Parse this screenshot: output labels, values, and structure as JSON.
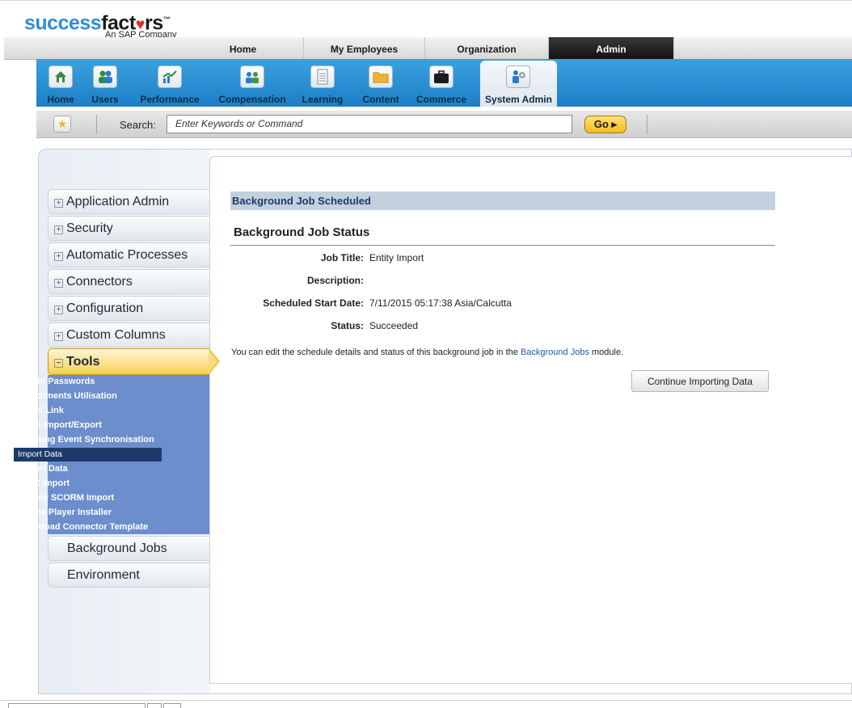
{
  "logo": {
    "part1": "success",
    "part2": "fact",
    "heart": "♥",
    "part3": "rs",
    "tm": "™",
    "subtitle": "An SAP Company"
  },
  "top_nav": [
    {
      "label": "Home",
      "active": false
    },
    {
      "label": "My Employees",
      "active": false
    },
    {
      "label": "Organization",
      "active": false
    },
    {
      "label": "Admin",
      "active": true
    }
  ],
  "modules": [
    {
      "label": "Home",
      "icon": "home-icon",
      "active": false
    },
    {
      "label": "Users",
      "icon": "users-icon",
      "active": false
    },
    {
      "label": "Performance",
      "icon": "performance-chart-icon",
      "active": false
    },
    {
      "label": "Compensation",
      "icon": "compensation-icon",
      "active": false
    },
    {
      "label": "Learning",
      "icon": "document-icon",
      "active": false
    },
    {
      "label": "Content",
      "icon": "folder-icon",
      "active": false
    },
    {
      "label": "Commerce",
      "icon": "briefcase-icon",
      "active": false
    },
    {
      "label": "System Admin",
      "icon": "system-admin-gear-icon",
      "active": true
    }
  ],
  "search": {
    "label": "Search:",
    "placeholder": "Enter Keywords or Command",
    "go_label": "Go ▸"
  },
  "sidebar": {
    "sections": [
      {
        "label": "Application Admin",
        "expand": "+"
      },
      {
        "label": "Security",
        "expand": "+"
      },
      {
        "label": "Automatic Processes",
        "expand": "+"
      },
      {
        "label": "Connectors",
        "expand": "+"
      },
      {
        "label": "Configuration",
        "expand": "+"
      },
      {
        "label": "Custom Columns",
        "expand": "+"
      }
    ],
    "tools": {
      "label": "Tools",
      "expand": "−"
    },
    "tools_items": [
      "Admin Passwords",
      "Attachments Utilisation",
      "Direct Link",
      "Label Import/Export",
      "Learning Event Synchronisation",
      "Import Data",
      "Export Data",
      "AICC Import",
      "Legacy SCORM Import",
      "Offline Player Installer",
      "Download Connector Template"
    ],
    "active_tool": "Import Data",
    "bottom_sections": [
      "Background Jobs",
      "Environment"
    ]
  },
  "job": {
    "header": "Background Job Scheduled",
    "title": "Background Job Status",
    "fields": [
      {
        "label": "Job Title:",
        "value": "Entity Import"
      },
      {
        "label": "Description:",
        "value": ""
      },
      {
        "label": "Scheduled Start Date:",
        "value": "7/11/2015 05:17:38 Asia/Calcutta"
      },
      {
        "label": "Status:",
        "value": "Succeeded"
      }
    ],
    "note_prefix": "You can edit the schedule details and status of this background job in the ",
    "note_link": "Background Jobs",
    "note_suffix": " module.",
    "continue_button": "Continue Importing Data"
  }
}
